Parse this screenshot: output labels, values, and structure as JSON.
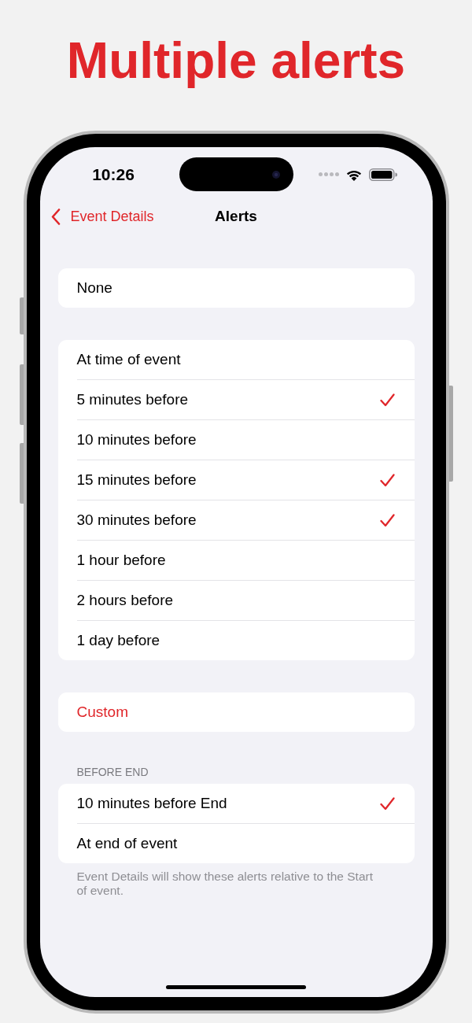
{
  "headline": "Multiple alerts",
  "status_bar": {
    "time": "10:26"
  },
  "nav_bar": {
    "back_label": "Event Details",
    "title": "Alerts"
  },
  "sections": [
    {
      "rows": [
        {
          "kind": "option",
          "label": "None",
          "selected": false
        }
      ]
    },
    {
      "rows": [
        {
          "kind": "option",
          "label": "At time of event",
          "selected": false
        },
        {
          "kind": "option",
          "label": "5 minutes before",
          "selected": true
        },
        {
          "kind": "option",
          "label": "10 minutes before",
          "selected": false
        },
        {
          "kind": "option",
          "label": "15 minutes before",
          "selected": true
        },
        {
          "kind": "option",
          "label": "30 minutes before",
          "selected": true
        },
        {
          "kind": "option",
          "label": "1 hour before",
          "selected": false
        },
        {
          "kind": "option",
          "label": "2 hours before",
          "selected": false
        },
        {
          "kind": "option",
          "label": "1 day before",
          "selected": false
        }
      ]
    },
    {
      "rows": [
        {
          "kind": "action",
          "label": "Custom"
        }
      ]
    },
    {
      "header": "BEFORE END",
      "rows": [
        {
          "kind": "option",
          "label": "10 minutes before End",
          "selected": true
        },
        {
          "kind": "option",
          "label": "At end of event",
          "selected": false
        }
      ],
      "footer": "Event Details will show these alerts relative to the Start of event."
    }
  ]
}
